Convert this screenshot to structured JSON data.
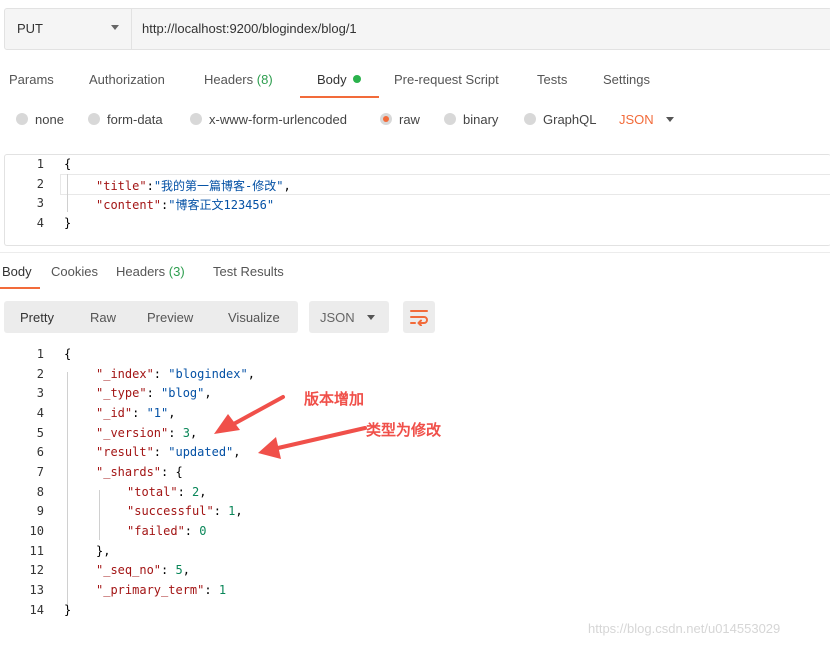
{
  "request": {
    "method": "PUT",
    "url": "http://localhost:9200/blogindex/blog/1"
  },
  "request_tabs": {
    "params": "Params",
    "authorization": "Authorization",
    "headers": "Headers",
    "headers_count": "(8)",
    "body": "Body",
    "prerequest": "Pre-request Script",
    "tests": "Tests",
    "settings": "Settings"
  },
  "body_types": {
    "none": "none",
    "form_data": "form-data",
    "urlencoded": "x-www-form-urlencoded",
    "raw": "raw",
    "binary": "binary",
    "graphql": "GraphQL",
    "language": "JSON",
    "selected": "raw"
  },
  "request_body": {
    "line_numbers": [
      "1",
      "2",
      "3",
      "4"
    ],
    "open_brace": "{",
    "close_brace": "}",
    "title_key": "\"title\"",
    "title_value": "\"我的第一篇博客-修改\"",
    "content_key": "\"content\"",
    "content_value": "\"博客正文123456\""
  },
  "response_tabs": {
    "body": "Body",
    "cookies": "Cookies",
    "headers": "Headers",
    "headers_count": "(3)",
    "test_results": "Test Results"
  },
  "response_toolbar": {
    "pretty": "Pretty",
    "raw": "Raw",
    "preview": "Preview",
    "visualize": "Visualize",
    "format": "JSON"
  },
  "response_body": {
    "line_numbers": [
      "1",
      "2",
      "3",
      "4",
      "5",
      "6",
      "7",
      "8",
      "9",
      "10",
      "11",
      "12",
      "13",
      "14"
    ],
    "open_brace": "{",
    "close_brace": "}",
    "index_key": "\"_index\"",
    "index_value": "\"blogindex\"",
    "type_key": "\"_type\"",
    "type_value": "\"blog\"",
    "id_key": "\"_id\"",
    "id_value": "\"1\"",
    "version_key": "\"_version\"",
    "version_value": "3",
    "result_key": "\"result\"",
    "result_value": "\"updated\"",
    "shards_key": "\"_shards\"",
    "total_key": "\"total\"",
    "total_value": "2",
    "successful_key": "\"successful\"",
    "successful_value": "1",
    "failed_key": "\"failed\"",
    "failed_value": "0",
    "shards_close": "},",
    "seq_no_key": "\"_seq_no\"",
    "seq_no_value": "5",
    "primary_term_key": "\"_primary_term\"",
    "primary_term_value": "1"
  },
  "annotations": {
    "version_note": "版本增加",
    "result_note": "类型为修改"
  },
  "watermark": "https://blog.csdn.net/u014553029",
  "colors": {
    "accent": "#f26b3a",
    "annotation": "#f0504a",
    "key": "#a31515",
    "string": "#0451a5",
    "number": "#098658",
    "status_green": "#2bb24c"
  }
}
